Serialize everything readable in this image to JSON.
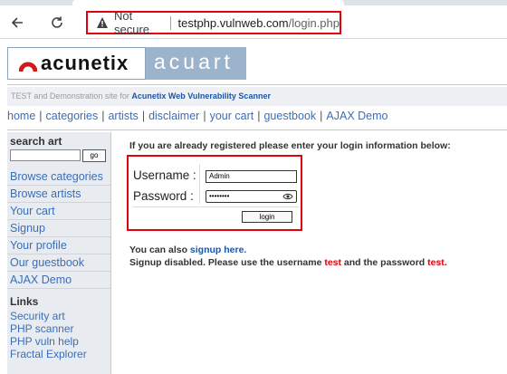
{
  "browser": {
    "security_label": "Not secure",
    "url_host": "testphp.vulnweb.com",
    "url_path": "/login.php"
  },
  "site": {
    "logo_word": "acunetix",
    "logo_word2": "acuart",
    "tagline_prefix": "TEST and Demonstration site for ",
    "tagline_link": "Acunetix Web Vulnerability Scanner"
  },
  "topnav": [
    "home",
    "categories",
    "artists",
    "disclaimer",
    "your cart",
    "guestbook",
    "AJAX Demo"
  ],
  "sidebar": {
    "search_title": "search art",
    "go_label": "go",
    "items": [
      "Browse categories",
      "Browse artists",
      "Your cart",
      "Signup",
      "Your profile",
      "Our guestbook",
      "AJAX Demo"
    ],
    "links_title": "Links",
    "links": [
      "Security art",
      "PHP scanner",
      "PHP vuln help",
      "Fractal Explorer"
    ]
  },
  "main": {
    "intro": "If you are already registered please enter your login information below:",
    "username_label": "Username :",
    "password_label": "Password :",
    "username_value": "Admin",
    "password_value": "••••••••",
    "login_label": "login",
    "signup_prefix": "You can also ",
    "signup_link": "signup here.",
    "disabled_prefix": "Signup disabled. Please use the username ",
    "disabled_user": "test",
    "disabled_mid": " and the password ",
    "disabled_pass": "test",
    "disabled_suffix": "."
  },
  "colors": {
    "highlight_red": "#e3000f",
    "link_blue": "#3a6fb9"
  }
}
